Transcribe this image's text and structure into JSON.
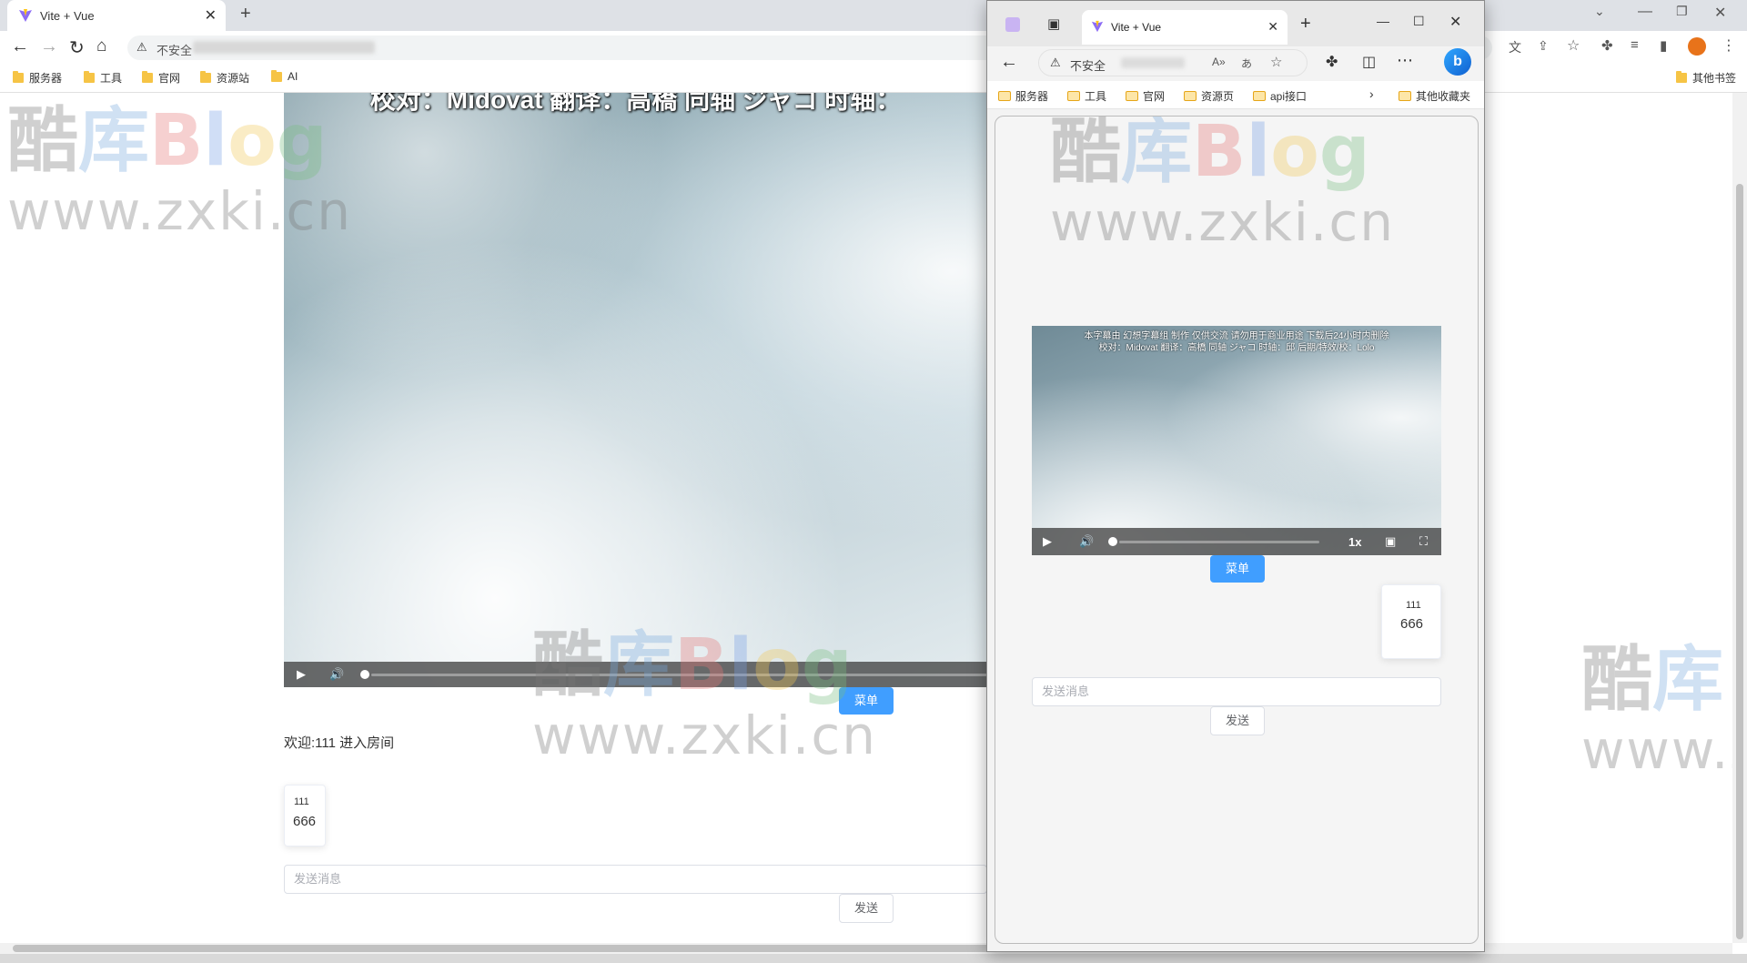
{
  "main_browser": {
    "tab_title": "Vite + Vue",
    "address_text": "不安全",
    "bookmarks": [
      "服务器",
      "工具",
      "官网",
      "资源站",
      "AI"
    ],
    "other_bookmarks": "其他书签"
  },
  "watermark": {
    "cn": [
      "酷",
      "库"
    ],
    "blog": [
      "B",
      "l",
      "o",
      "g"
    ],
    "url": "www.zxki.cn"
  },
  "room_page": {
    "video_subtitle": "校对：Midovat 翻译：高橋 同轴 ジャコ 时轴：",
    "menu_label": "菜单",
    "welcome_text": "欢迎:111 进入房间",
    "message": {
      "user": "111",
      "text": "666"
    },
    "input_placeholder": "发送消息",
    "send_label": "发送"
  },
  "popup_browser": {
    "tab_title": "Vite + Vue",
    "address_text": "不安全",
    "bookmarks": [
      "服务器",
      "工具",
      "官网",
      "资源页",
      "api接口"
    ],
    "other_bookmarks": "其他收藏夹",
    "video_subtitle_line1": "本字幕由 幻想字幕组 制作 仅供交流 请勿用于商业用途 下载后24小时内删除",
    "video_subtitle_line2": "校对：Midovat 翻译：高橋 同轴 ジャコ 时轴：邱 后期/特效/校：Lolo",
    "speed_label": "1x",
    "menu_label": "菜单",
    "message": {
      "user": "111",
      "text": "666"
    },
    "input_placeholder": "发送消息",
    "send_label": "发送"
  },
  "colors": {
    "accent": "#409eff",
    "tab_bar": "#dee1e6"
  }
}
